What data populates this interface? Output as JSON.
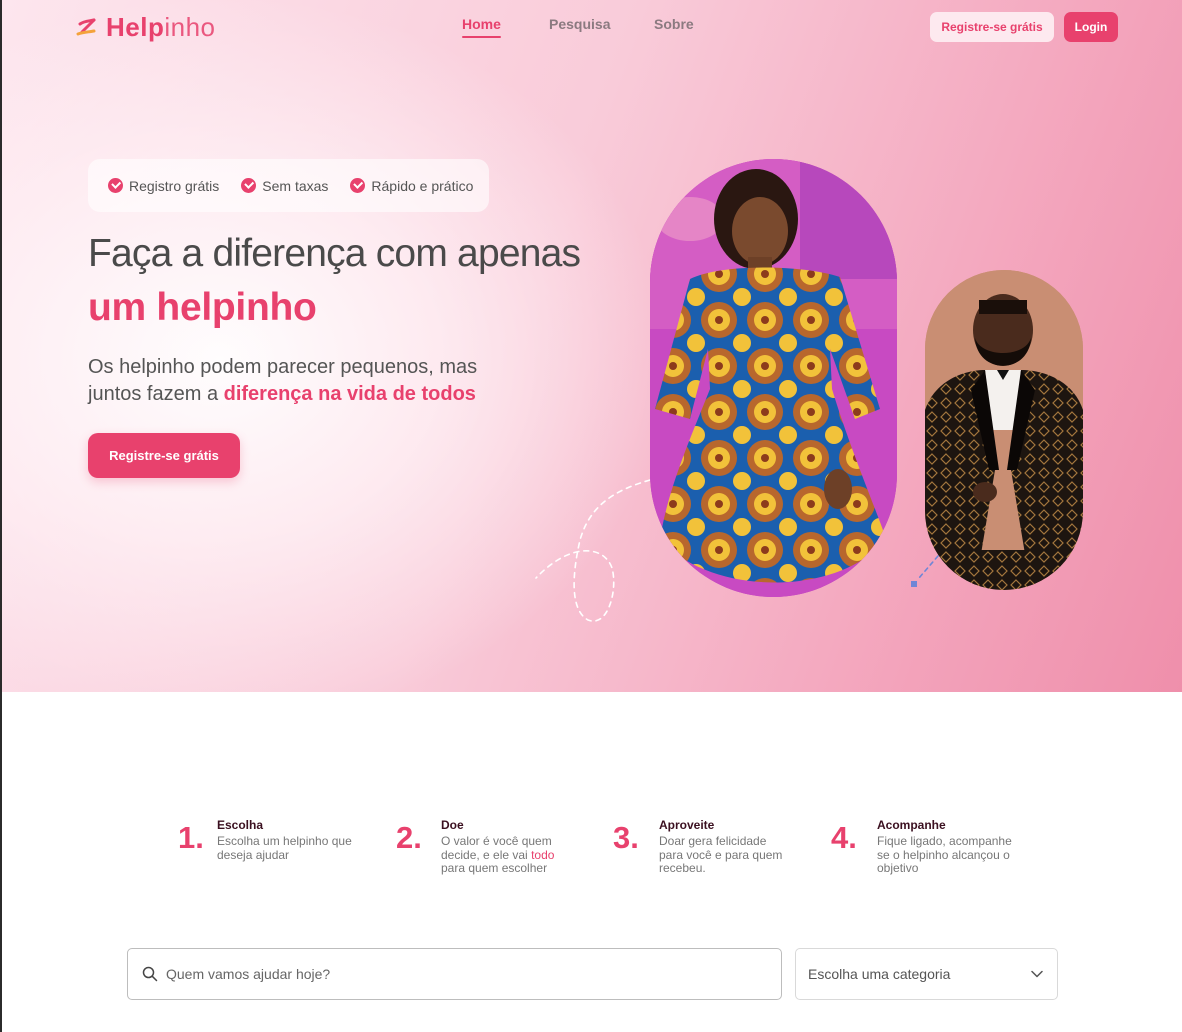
{
  "brand": {
    "name_bold": "Help",
    "name_light": "inho",
    "accent": "#e8416d"
  },
  "nav": {
    "items": [
      {
        "label": "Home",
        "active": true
      },
      {
        "label": "Pesquisa",
        "active": false
      },
      {
        "label": "Sobre",
        "active": false
      }
    ],
    "register_label": "Registre-se grátis",
    "login_label": "Login"
  },
  "hero": {
    "perks": [
      "Registro grátis",
      "Sem taxas",
      "Rápido e prático"
    ],
    "headline": "Faça a diferença com apenas",
    "headline_emphasis": "um helpinho",
    "sub_line1": "Os helpinho podem parecer pequenos, mas",
    "sub_line2_prefix": "juntos fazem a ",
    "sub_line2_emphasis": "diferença na vida de todos",
    "cta_label": "Registre-se grátis"
  },
  "steps": [
    {
      "number": "1.",
      "title": "Escolha",
      "desc_lines": [
        "Escolha um helpinho que",
        "deseja ajudar"
      ]
    },
    {
      "number": "2.",
      "title": "Doe",
      "desc_line1": "O valor é você quem",
      "desc_line2_prefix": "decide, e ele vai ",
      "desc_line2_highlight": "todo",
      "desc_line3": "para quem escolher"
    },
    {
      "number": "3.",
      "title": "Aproveite",
      "desc_lines": [
        "Doar gera felicidade",
        "para você e para quem",
        "recebeu."
      ]
    },
    {
      "number": "4.",
      "title": "Acompanhe",
      "desc_lines": [
        "Fique ligado, acompanhe",
        "se o helpinho alcançou o",
        "objetivo"
      ]
    }
  ],
  "search": {
    "placeholder": "Quem vamos ajudar hoje?"
  },
  "category": {
    "selected": "Escolha uma categoria"
  }
}
